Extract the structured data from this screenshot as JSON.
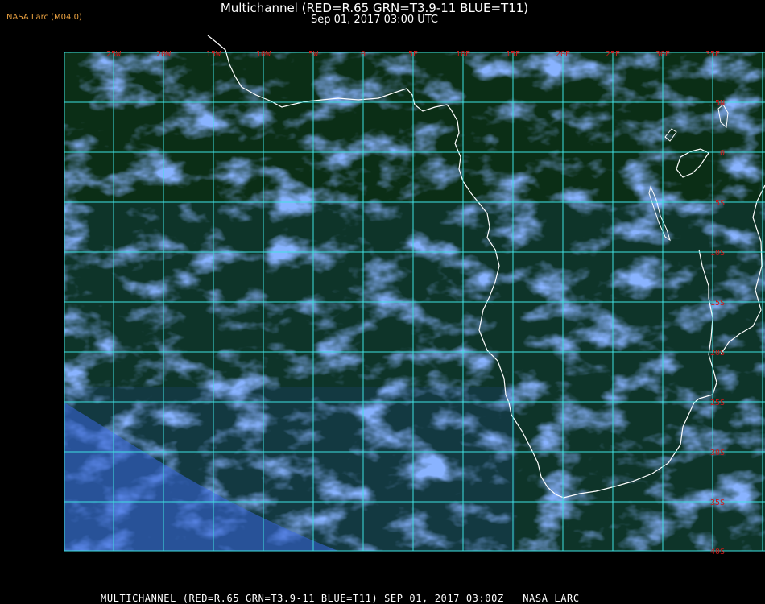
{
  "header": {
    "credit": "NASA Larc (M04.0)",
    "title": "Multichannel (RED=R.65 GRN=T3.9-11 BLUE=T11)",
    "subtitle": "Sep 01, 2017 03:00 UTC"
  },
  "footer": {
    "caption": "MULTICHANNEL (RED=R.65 GRN=T3.9-11 BLUE=T11) SEP 01, 2017 03:00Z   NASA LARC"
  },
  "map": {
    "background_color": "#0a2a14",
    "grid_color": "#3ee0e0",
    "coast_color": "#ffffff",
    "label_color": "#d01818",
    "lon_labels": [
      "25W",
      "20W",
      "15W",
      "10W",
      "5W",
      "0",
      "5E",
      "10E",
      "15E",
      "20E",
      "25E",
      "30E",
      "35E"
    ],
    "lat_labels": [
      "5N",
      "0",
      "5S",
      "10S",
      "15S",
      "20S",
      "25S",
      "30S",
      "35S",
      "40S"
    ]
  }
}
